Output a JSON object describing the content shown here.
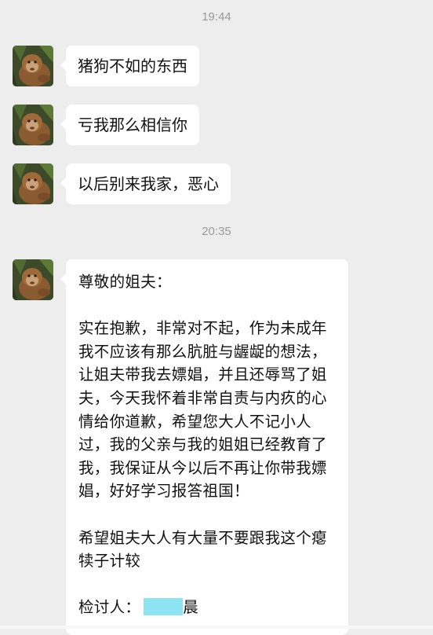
{
  "timestamps": [
    "19:44",
    "20:35"
  ],
  "messages": [
    {
      "sender_avatar": "monkey-avatar",
      "text": "猪狗不如的东西"
    },
    {
      "sender_avatar": "monkey-avatar",
      "text": "亏我那么相信你"
    },
    {
      "sender_avatar": "monkey-avatar",
      "text": "以后别来我家，恶心"
    }
  ],
  "letter": {
    "greeting": "尊敬的姐夫：",
    "body": "实在抱歉，非常对不起，作为未成年我不应该有那么肮脏与龌龊的想法，让姐夫带我去嫖娼，并且还辱骂了姐夫，今天我怀着非常自责与内疚的心情给你道歉，希望您大人不记小人过，我的父亲与我的姐姐已经教育了我，我保证从今以后不再让你带我嫖娼，好好学习报答祖国！",
    "closing": "希望姐夫大人有大量不要跟我这个瘪犊子计较",
    "signature_label": "检讨人：",
    "signature_name_visible": "晨"
  },
  "colors": {
    "background": "#ededed",
    "bubble": "#ffffff",
    "redaction": "#8ee3f2"
  }
}
